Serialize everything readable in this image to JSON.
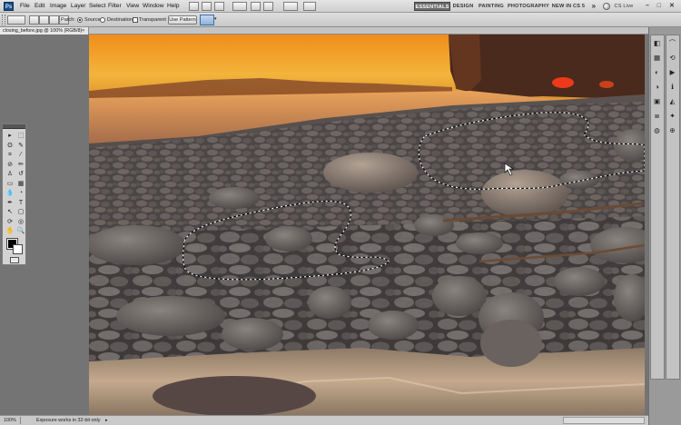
{
  "app": {
    "logo": "Ps"
  },
  "menubar": {
    "items": [
      "File",
      "Edit",
      "Image",
      "Layer",
      "Select",
      "Filter",
      "View",
      "Window",
      "Help"
    ],
    "workspaces": [
      "ESSENTIALS",
      "DESIGN",
      "PAINTING",
      "PHOTOGRAPHY",
      "NEW IN CS 5"
    ],
    "active_workspace": "ESSENTIALS",
    "more": "»",
    "cs_live": "CS Live",
    "window_controls": [
      "–",
      "□",
      "✕"
    ]
  },
  "options_bar": {
    "patch_label": "Patch:",
    "source_label": "Source",
    "destination_label": "Destination",
    "transparent_label": "Transparent",
    "use_pattern_label": "Use Pattern",
    "selected_mode": "source"
  },
  "document": {
    "tab_title": "closing_before.jpg @ 100% (RGB/8)",
    "close_glyph": "×"
  },
  "status": {
    "zoom": "100%",
    "message": "Exposure works in 32-bit only"
  },
  "colors": {
    "foreground": "#000000",
    "background": "#ffffff",
    "chrome": "#d3d3d3",
    "workspace_active": "#6c6c6c"
  },
  "tools": [
    {
      "name": "move-tool-icon",
      "glyph": "▸"
    },
    {
      "name": "marquee-tool-icon",
      "glyph": "⬚"
    },
    {
      "name": "lasso-tool-icon",
      "glyph": "ʘ"
    },
    {
      "name": "quick-select-tool-icon",
      "glyph": "✎"
    },
    {
      "name": "crop-tool-icon",
      "glyph": "⌗"
    },
    {
      "name": "eyedropper-tool-icon",
      "glyph": "⁄"
    },
    {
      "name": "patch-tool-icon",
      "glyph": "⊘"
    },
    {
      "name": "brush-tool-icon",
      "glyph": "✏"
    },
    {
      "name": "clone-stamp-tool-icon",
      "glyph": "♙"
    },
    {
      "name": "history-brush-tool-icon",
      "glyph": "↺"
    },
    {
      "name": "eraser-tool-icon",
      "glyph": "▭"
    },
    {
      "name": "gradient-tool-icon",
      "glyph": "▦"
    },
    {
      "name": "blur-tool-icon",
      "glyph": "💧"
    },
    {
      "name": "dodge-tool-icon",
      "glyph": "◔"
    },
    {
      "name": "pen-tool-icon",
      "glyph": "✒"
    },
    {
      "name": "type-tool-icon",
      "glyph": "T"
    },
    {
      "name": "path-select-tool-icon",
      "glyph": "↖"
    },
    {
      "name": "shape-tool-icon",
      "glyph": "▢"
    },
    {
      "name": "3d-rotate-tool-icon",
      "glyph": "⟳"
    },
    {
      "name": "3d-camera-tool-icon",
      "glyph": "◎"
    },
    {
      "name": "hand-tool-icon",
      "glyph": "✋"
    },
    {
      "name": "zoom-tool-icon",
      "glyph": "🔍"
    }
  ],
  "dock": [
    {
      "name": "color-panel-icon",
      "glyph": "◧"
    },
    {
      "name": "swatches-panel-icon",
      "glyph": "▦"
    },
    {
      "name": "styles-panel-icon",
      "glyph": "◐"
    },
    {
      "name": "adjustments-panel-icon",
      "glyph": "◑"
    },
    {
      "name": "masks-panel-icon",
      "glyph": "▣"
    },
    {
      "name": "layers-panel-icon",
      "glyph": "≣"
    },
    {
      "name": "channels-panel-icon",
      "glyph": "◍"
    },
    {
      "name": "paths-panel-icon",
      "glyph": "⌒"
    },
    {
      "name": "history-panel-icon",
      "glyph": "⟲"
    },
    {
      "name": "actions-panel-icon",
      "glyph": "▶"
    },
    {
      "name": "info-panel-icon",
      "glyph": "ℹ"
    },
    {
      "name": "navigator-panel-icon",
      "glyph": "◭"
    },
    {
      "name": "brushes-panel-icon",
      "glyph": "✦"
    },
    {
      "name": "clone-source-panel-icon",
      "glyph": "⊕"
    }
  ]
}
